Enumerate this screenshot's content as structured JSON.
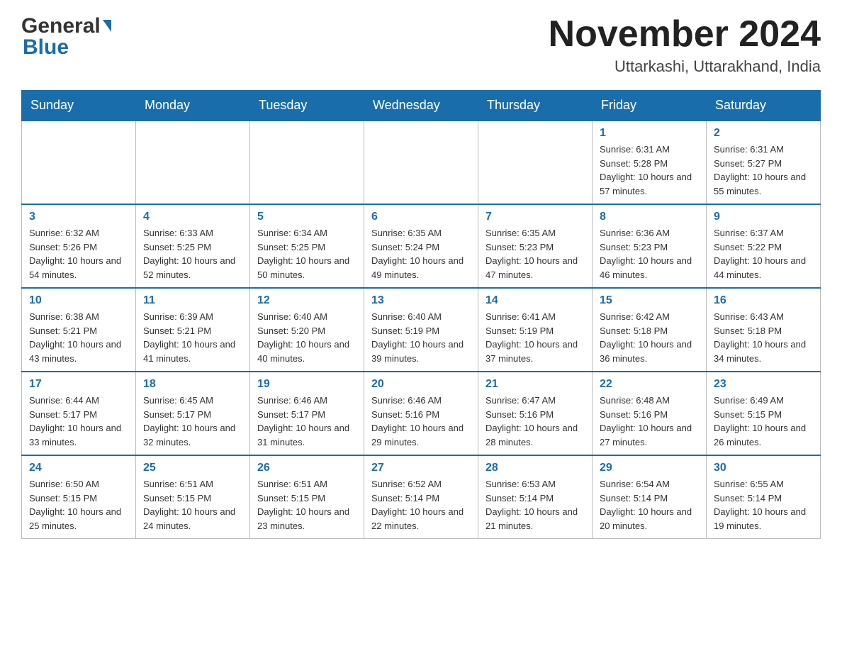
{
  "header": {
    "logo_main": "General",
    "logo_sub": "Blue",
    "month": "November 2024",
    "location": "Uttarkashi, Uttarakhand, India"
  },
  "days_of_week": [
    "Sunday",
    "Monday",
    "Tuesday",
    "Wednesday",
    "Thursday",
    "Friday",
    "Saturday"
  ],
  "weeks": [
    [
      {
        "day": "",
        "info": ""
      },
      {
        "day": "",
        "info": ""
      },
      {
        "day": "",
        "info": ""
      },
      {
        "day": "",
        "info": ""
      },
      {
        "day": "",
        "info": ""
      },
      {
        "day": "1",
        "info": "Sunrise: 6:31 AM\nSunset: 5:28 PM\nDaylight: 10 hours and 57 minutes."
      },
      {
        "day": "2",
        "info": "Sunrise: 6:31 AM\nSunset: 5:27 PM\nDaylight: 10 hours and 55 minutes."
      }
    ],
    [
      {
        "day": "3",
        "info": "Sunrise: 6:32 AM\nSunset: 5:26 PM\nDaylight: 10 hours and 54 minutes."
      },
      {
        "day": "4",
        "info": "Sunrise: 6:33 AM\nSunset: 5:25 PM\nDaylight: 10 hours and 52 minutes."
      },
      {
        "day": "5",
        "info": "Sunrise: 6:34 AM\nSunset: 5:25 PM\nDaylight: 10 hours and 50 minutes."
      },
      {
        "day": "6",
        "info": "Sunrise: 6:35 AM\nSunset: 5:24 PM\nDaylight: 10 hours and 49 minutes."
      },
      {
        "day": "7",
        "info": "Sunrise: 6:35 AM\nSunset: 5:23 PM\nDaylight: 10 hours and 47 minutes."
      },
      {
        "day": "8",
        "info": "Sunrise: 6:36 AM\nSunset: 5:23 PM\nDaylight: 10 hours and 46 minutes."
      },
      {
        "day": "9",
        "info": "Sunrise: 6:37 AM\nSunset: 5:22 PM\nDaylight: 10 hours and 44 minutes."
      }
    ],
    [
      {
        "day": "10",
        "info": "Sunrise: 6:38 AM\nSunset: 5:21 PM\nDaylight: 10 hours and 43 minutes."
      },
      {
        "day": "11",
        "info": "Sunrise: 6:39 AM\nSunset: 5:21 PM\nDaylight: 10 hours and 41 minutes."
      },
      {
        "day": "12",
        "info": "Sunrise: 6:40 AM\nSunset: 5:20 PM\nDaylight: 10 hours and 40 minutes."
      },
      {
        "day": "13",
        "info": "Sunrise: 6:40 AM\nSunset: 5:19 PM\nDaylight: 10 hours and 39 minutes."
      },
      {
        "day": "14",
        "info": "Sunrise: 6:41 AM\nSunset: 5:19 PM\nDaylight: 10 hours and 37 minutes."
      },
      {
        "day": "15",
        "info": "Sunrise: 6:42 AM\nSunset: 5:18 PM\nDaylight: 10 hours and 36 minutes."
      },
      {
        "day": "16",
        "info": "Sunrise: 6:43 AM\nSunset: 5:18 PM\nDaylight: 10 hours and 34 minutes."
      }
    ],
    [
      {
        "day": "17",
        "info": "Sunrise: 6:44 AM\nSunset: 5:17 PM\nDaylight: 10 hours and 33 minutes."
      },
      {
        "day": "18",
        "info": "Sunrise: 6:45 AM\nSunset: 5:17 PM\nDaylight: 10 hours and 32 minutes."
      },
      {
        "day": "19",
        "info": "Sunrise: 6:46 AM\nSunset: 5:17 PM\nDaylight: 10 hours and 31 minutes."
      },
      {
        "day": "20",
        "info": "Sunrise: 6:46 AM\nSunset: 5:16 PM\nDaylight: 10 hours and 29 minutes."
      },
      {
        "day": "21",
        "info": "Sunrise: 6:47 AM\nSunset: 5:16 PM\nDaylight: 10 hours and 28 minutes."
      },
      {
        "day": "22",
        "info": "Sunrise: 6:48 AM\nSunset: 5:16 PM\nDaylight: 10 hours and 27 minutes."
      },
      {
        "day": "23",
        "info": "Sunrise: 6:49 AM\nSunset: 5:15 PM\nDaylight: 10 hours and 26 minutes."
      }
    ],
    [
      {
        "day": "24",
        "info": "Sunrise: 6:50 AM\nSunset: 5:15 PM\nDaylight: 10 hours and 25 minutes."
      },
      {
        "day": "25",
        "info": "Sunrise: 6:51 AM\nSunset: 5:15 PM\nDaylight: 10 hours and 24 minutes."
      },
      {
        "day": "26",
        "info": "Sunrise: 6:51 AM\nSunset: 5:15 PM\nDaylight: 10 hours and 23 minutes."
      },
      {
        "day": "27",
        "info": "Sunrise: 6:52 AM\nSunset: 5:14 PM\nDaylight: 10 hours and 22 minutes."
      },
      {
        "day": "28",
        "info": "Sunrise: 6:53 AM\nSunset: 5:14 PM\nDaylight: 10 hours and 21 minutes."
      },
      {
        "day": "29",
        "info": "Sunrise: 6:54 AM\nSunset: 5:14 PM\nDaylight: 10 hours and 20 minutes."
      },
      {
        "day": "30",
        "info": "Sunrise: 6:55 AM\nSunset: 5:14 PM\nDaylight: 10 hours and 19 minutes."
      }
    ]
  ]
}
